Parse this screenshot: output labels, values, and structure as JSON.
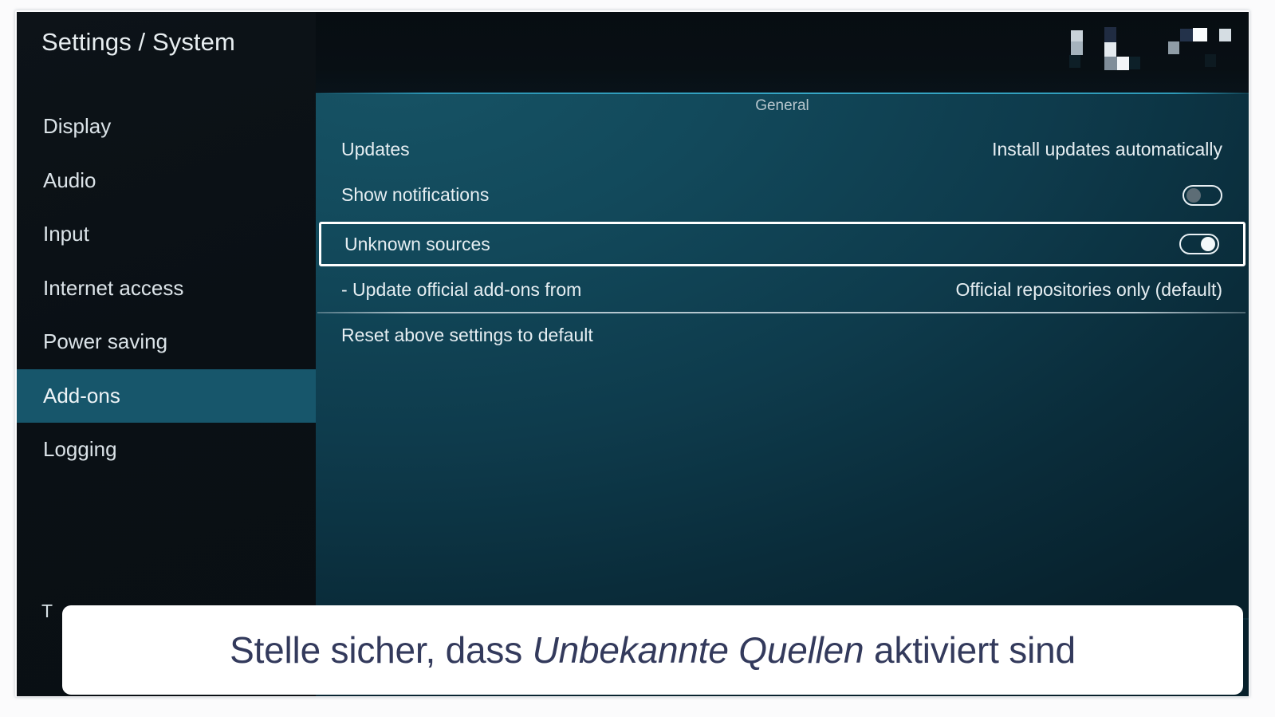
{
  "window": {
    "title": "Settings / System"
  },
  "sidebar": {
    "items": [
      {
        "label": "Display",
        "selected": false
      },
      {
        "label": "Audio",
        "selected": false
      },
      {
        "label": "Input",
        "selected": false
      },
      {
        "label": "Internet access",
        "selected": false
      },
      {
        "label": "Power saving",
        "selected": false
      },
      {
        "label": "Add-ons",
        "selected": true
      },
      {
        "label": "Logging",
        "selected": false
      }
    ],
    "occluded_bottom_text": "T"
  },
  "status_icons": [
    {
      "name": "redacted-pixel-icon-1"
    },
    {
      "name": "redacted-pixel-icon-2"
    },
    {
      "name": "redacted-pixel-icon-3"
    }
  ],
  "main": {
    "group_header": "General",
    "rows": [
      {
        "name": "updates",
        "label": "Updates",
        "type": "value",
        "value": "Install updates automatically",
        "focused": false
      },
      {
        "name": "show-notifications",
        "label": "Show notifications",
        "type": "toggle",
        "toggle_state": "off",
        "focused": false
      },
      {
        "name": "unknown-sources",
        "label": "Unknown sources",
        "type": "toggle",
        "toggle_state": "on",
        "focused": true
      },
      {
        "name": "update-official-add-ons-from",
        "label": "- Update official add-ons from",
        "type": "value",
        "value": "Official repositories only (default)",
        "focused": false
      },
      {
        "name": "reset-above-settings-to-default",
        "label": "Reset above settings to default",
        "type": "action",
        "value": "",
        "focused": false
      }
    ]
  },
  "caption": {
    "prefix": "Stelle sicher, dass ",
    "emphasis": "Unbekannte Quellen",
    "suffix": " aktiviert sind"
  },
  "colors": {
    "sidebar_bg": "#0a1015",
    "sidebar_selected": "#17566b",
    "panel_accent_line": "#2e9ab8",
    "focus_border": "#ffffff",
    "caption_bg": "#ffffff",
    "caption_text": "#333a5c",
    "text_primary": "#e6eef2"
  }
}
